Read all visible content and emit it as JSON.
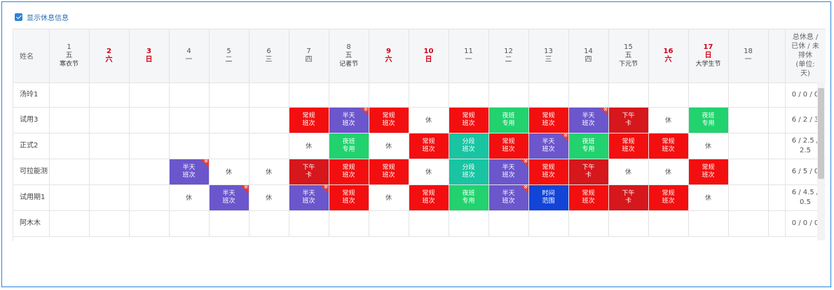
{
  "option": {
    "label": "显示休息信息",
    "checked": true
  },
  "header": {
    "name_col": "姓名",
    "summary_col": "总休息 /\n已休 / 未\n排休\n(单位:\n天)",
    "days": [
      {
        "d": "1",
        "w": "五",
        "f": "寒衣节",
        "red": false
      },
      {
        "d": "2",
        "w": "六",
        "f": "",
        "red": true
      },
      {
        "d": "3",
        "w": "日",
        "f": "",
        "red": true
      },
      {
        "d": "4",
        "w": "一",
        "f": "",
        "red": false
      },
      {
        "d": "5",
        "w": "二",
        "f": "",
        "red": false
      },
      {
        "d": "6",
        "w": "三",
        "f": "",
        "red": false
      },
      {
        "d": "7",
        "w": "四",
        "f": "",
        "red": false
      },
      {
        "d": "8",
        "w": "五",
        "f": "记者节",
        "red": false
      },
      {
        "d": "9",
        "w": "六",
        "f": "",
        "red": true
      },
      {
        "d": "10",
        "w": "日",
        "f": "",
        "red": true
      },
      {
        "d": "11",
        "w": "一",
        "f": "",
        "red": false
      },
      {
        "d": "12",
        "w": "二",
        "f": "",
        "red": false
      },
      {
        "d": "13",
        "w": "三",
        "f": "",
        "red": false
      },
      {
        "d": "14",
        "w": "四",
        "f": "",
        "red": false
      },
      {
        "d": "15",
        "w": "五",
        "f": "下元节",
        "red": false
      },
      {
        "d": "16",
        "w": "六",
        "f": "",
        "red": true
      },
      {
        "d": "17",
        "w": "日",
        "f": "大学生节",
        "red": true
      },
      {
        "d": "18",
        "w": "一",
        "f": "",
        "red": false
      }
    ]
  },
  "colors": {
    "常规班次": "#f30f0f",
    "半天班次": "#6b56cc",
    "夜班专用": "#22d26e",
    "下午卡": "#d6171c",
    "分段班次": "#19c4a3",
    "时间范围": "#1244d8"
  },
  "rest_label": "休",
  "rows": [
    {
      "name": "汤玲1",
      "summary": "0 / 0 / 0",
      "cells": [
        "",
        "",
        "",
        "",
        "",
        "",
        "",
        "",
        "",
        "",
        "",
        "",
        "",
        "",
        "",
        "",
        "",
        ""
      ]
    },
    {
      "name": "试用3",
      "summary": "6 / 2 / 3",
      "cells": [
        "",
        "",
        "",
        "",
        "",
        "",
        "常规班次",
        "半天班次*",
        "常规班次",
        "休",
        "常规班次",
        "夜班专用",
        "常规班次",
        "半天班次*",
        "下午卡",
        "休",
        "夜班专用",
        ""
      ]
    },
    {
      "name": "正式2",
      "summary": "6 / 2.5 / 2.5",
      "cells": [
        "",
        "",
        "",
        "",
        "",
        "",
        "休",
        "夜班专用",
        "休",
        "常规班次",
        "分段班次",
        "常规班次",
        "半天班次*",
        "夜班专用",
        "常规班次",
        "常规班次",
        "休",
        ""
      ]
    },
    {
      "name": "可拉能测",
      "summary": "6 / 5 / 0",
      "cells": [
        "",
        "",
        "",
        "半天班次*",
        "休",
        "休",
        "下午卡",
        "常规班次",
        "常规班次",
        "休",
        "分段班次",
        "半天班次*",
        "常规班次",
        "下午卡",
        "休",
        "休",
        "常规班次",
        ""
      ]
    },
    {
      "name": "试用期1",
      "summary": "6 / 4.5 / 0.5",
      "cells": [
        "",
        "",
        "",
        "休",
        "半天班次*",
        "休",
        "半天班次*",
        "常规班次",
        "休",
        "常规班次",
        "夜班专用",
        "半天班次*",
        "时间范围",
        "常规班次",
        "下午卡",
        "常规班次",
        "休",
        ""
      ]
    },
    {
      "name": "阿木木",
      "summary": "0 / 0 / 0",
      "cells": [
        "",
        "",
        "",
        "",
        "",
        "",
        "",
        "",
        "",
        "",
        "",
        "",
        "",
        "",
        "",
        "",
        "",
        ""
      ]
    }
  ]
}
